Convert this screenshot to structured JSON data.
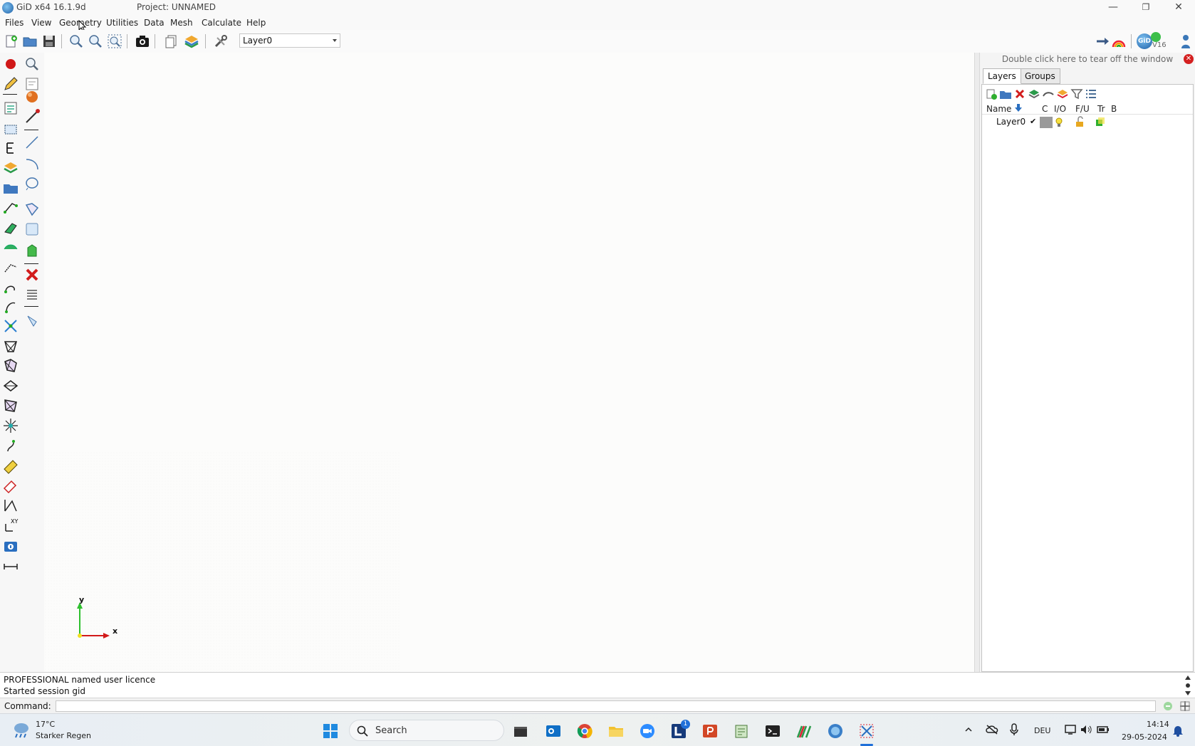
{
  "window": {
    "app_title": "GiD x64 16.1.9d",
    "project_title": "Project: UNNAMED",
    "minimize": "—",
    "maximize": "❐",
    "close": "✕"
  },
  "menu": [
    "Files",
    "View",
    "Geometry",
    "Utilities",
    "Data",
    "Mesh",
    "Calculate",
    "Help"
  ],
  "toolbar": {
    "layer_select_value": "Layer0",
    "icons": [
      "new-file-icon",
      "open-folder-icon",
      "save-icon",
      "zoom-in-icon",
      "zoom-out-icon",
      "zoom-frame-icon",
      "camera-icon",
      "copy-page-icon",
      "layers-stack-icon",
      "tools-icon"
    ],
    "right_icons": [
      "arrow-right-icon",
      "rainbow-icon",
      "gid-logo-icon",
      "user-icon"
    ],
    "logo_text": "GiD",
    "version_badge": "V16"
  },
  "left_toolbar": [
    "point-red-icon",
    "zoom-icon",
    "pencil-icon",
    "frame-icon",
    "sphere-icon",
    "notes-icon",
    "measure-icon",
    "select-box-icon",
    "line-icon",
    "edit-text-icon",
    "arc-icon",
    "layers-icon",
    "circle-icon",
    "folder-icon",
    "nurbs-icon",
    "polyline-icon",
    "surface-icon",
    "rect-surface-icon",
    "mesh-surface-icon",
    "volume-icon",
    "move-icon",
    "delete-icon",
    "list-icon",
    "edit-curve-icon",
    "copy-icon",
    "intersect-icon",
    "hoop-icon",
    "mesh-edit-icon",
    "mesh-volume-icon",
    "mesh-tri-icon",
    "mesh-quad-icon",
    "mesh-star-icon",
    "pin-icon",
    "ruler-icon",
    "eraser-icon",
    "dimension-icon",
    "xy-axis-icon",
    "info-icon",
    "distance-icon"
  ],
  "axes": {
    "y_label": "y",
    "x_label": "x"
  },
  "right_panel": {
    "tearoff_text": "Double click here to tear off the window",
    "tabs": [
      {
        "label": "Layers"
      },
      {
        "label": "Groups"
      }
    ],
    "layer_tools": [
      "new-layer-icon",
      "new-sublayer-icon",
      "delete-layer-icon",
      "layer-stack-icon",
      "rename-icon",
      "palette-icon",
      "filter-icon",
      "list-view-icon"
    ],
    "columns": [
      "Name",
      "C",
      "I/O",
      "F/U",
      "Tr",
      "B"
    ],
    "layers": [
      {
        "name": "Layer0",
        "check": "✔"
      }
    ]
  },
  "output": {
    "line1": "PROFESSIONAL named user licence",
    "line2": "Started session gid"
  },
  "command": {
    "label": "Command:"
  },
  "taskbar": {
    "weather_temp": "17°C",
    "weather_desc": "Starker Regen",
    "search": "Search",
    "apps": [
      "windows-start-icon",
      "search-icon",
      "terminal-dark-icon",
      "outlook-icon",
      "chrome-icon",
      "file-explorer-icon",
      "zoom-app-icon",
      "app-l-icon",
      "powerpoint-icon",
      "notepad-icon",
      "terminal-icon",
      "matlab-icon",
      "gid-app-icon",
      "snipping-tool-icon"
    ],
    "badge": "1",
    "lang": "DEU",
    "time": "14:14",
    "date": "29-05-2024"
  }
}
